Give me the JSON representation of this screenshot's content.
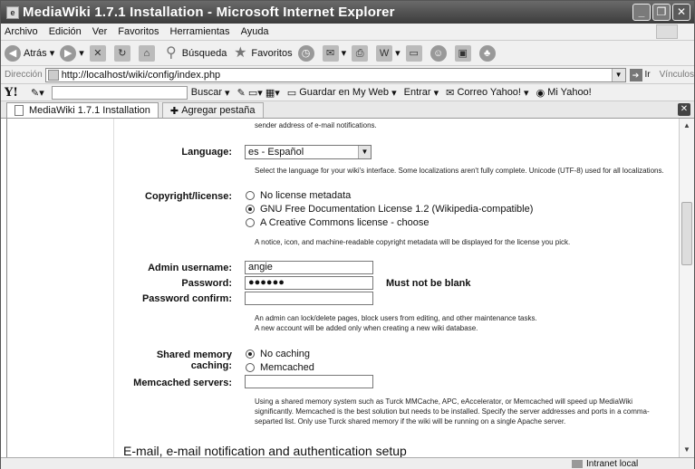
{
  "window": {
    "title": "MediaWiki 1.7.1 Installation - Microsoft Internet Explorer"
  },
  "menu": [
    "Archivo",
    "Edición",
    "Ver",
    "Favoritos",
    "Herramientas",
    "Ayuda"
  ],
  "toolbar": {
    "back": "Atrás",
    "search": "Búsqueda",
    "favorites": "Favoritos"
  },
  "address": {
    "label": "Dirección",
    "url": "http://localhost/wiki/config/index.php",
    "go": "Ir",
    "links": "Vínculos"
  },
  "yahoo": {
    "logo": "Y!",
    "search": "Buscar",
    "save": "Guardar en My Web",
    "enter": "Entrar",
    "mail": "Correo Yahoo!",
    "my": "Mi Yahoo!"
  },
  "tabs": {
    "active": "MediaWiki 1.7.1 Installation",
    "add": "Agregar pestaña"
  },
  "form": {
    "top_desc": "sender address of e-mail notifications.",
    "language_label": "Language:",
    "language_value": "es - Español",
    "language_desc": "Select the language for your wiki's interface. Some localizations aren't fully complete. Unicode (UTF-8) used for all localizations.",
    "copyright_label": "Copyright/license:",
    "copyright_opts": [
      "No license metadata",
      "GNU Free Documentation License 1.2 (Wikipedia-compatible)",
      "A Creative Commons license - choose"
    ],
    "copyright_desc": "A notice, icon, and machine-readable copyright metadata will be displayed for the license you pick.",
    "admin_label": "Admin username:",
    "admin_value": "angie",
    "password_label": "Password:",
    "password_value": "●●●●●●",
    "password_error": "Must not be blank",
    "confirm_label": "Password confirm:",
    "admin_desc1": "An admin can lock/delete pages, block users from editing, and other maintenance tasks.",
    "admin_desc2": "A new account will be added only when creating a new wiki database.",
    "cache_label": "Shared memory caching:",
    "cache_opts": [
      "No caching",
      "Memcached"
    ],
    "memcached_label": "Memcached servers:",
    "cache_desc1": "Using a shared memory system such as Turck MMCache, APC, eAccelerator, or Memcached will speed up MediaWiki",
    "cache_desc2": "significantly. Memcached is the best solution but needs to be installed. Specify the server addresses and ports in a comma-",
    "cache_desc3": "separted list. Only use Turck shared memory if the wiki will be running on a single Apache server.",
    "section_heading": "E-mail, e-mail notification and authentication setup"
  },
  "status": {
    "zone": "Intranet local"
  }
}
